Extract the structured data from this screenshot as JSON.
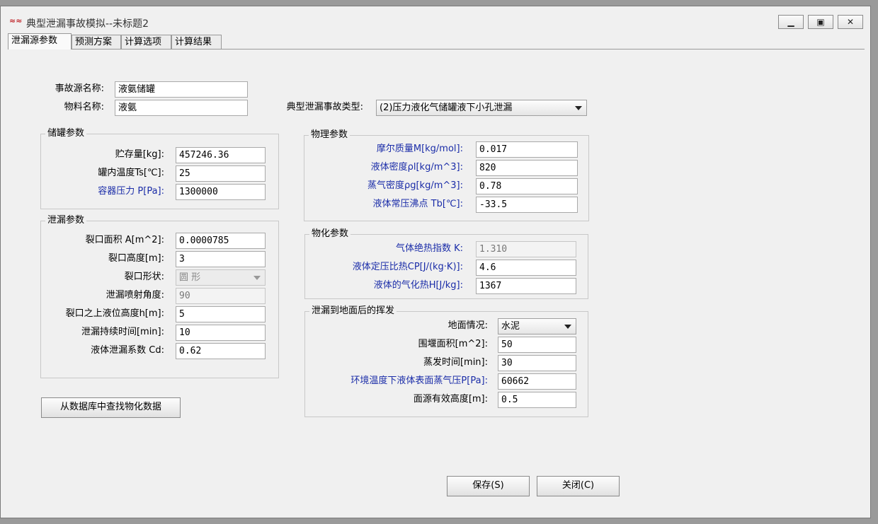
{
  "window": {
    "title": "典型泄漏事故模拟--未标题2",
    "minimize_glyph": "▁",
    "restore_glyph": "▣",
    "close_glyph": "✕"
  },
  "tabs": [
    "泄漏源参数",
    "预测方案",
    "计算选项",
    "计算结果"
  ],
  "top": {
    "source_name_label": "事故源名称:",
    "source_name_value": "液氨储罐",
    "material_label": "物料名称:",
    "material_value": "液氨",
    "accident_type_label": "典型泄漏事故类型:",
    "accident_type_value": "(2)压力液化气储罐液下小孔泄漏"
  },
  "tank": {
    "title": "储罐参数",
    "rows": [
      {
        "label": "贮存量[kg]:",
        "value": "457246.36"
      },
      {
        "label": "罐内温度Ts[℃]:",
        "value": "25"
      },
      {
        "label": "容器压力 P[Pa]:",
        "value": "1300000"
      }
    ]
  },
  "leak": {
    "title": "泄漏参数",
    "area_label": "裂口面积 A[m^2]:",
    "area_value": "0.0000785",
    "height_label": "裂口高度[m]:",
    "height_value": "3",
    "shape_label": "裂口形状:",
    "shape_value": "圆  形",
    "angle_label": "泄漏喷射角度:",
    "angle_value": "90",
    "level_label": "裂口之上液位高度h[m]:",
    "level_value": "5",
    "duration_label": "泄漏持续时间[min]:",
    "duration_value": "10",
    "coef_label": "液体泄漏系数  Cd:",
    "coef_value": "0.62"
  },
  "lookup_button": "从数据库中查找物化数据",
  "physical": {
    "title": "物理参数",
    "rows": [
      {
        "label": "摩尔质量M[kg/mol]:",
        "value": "0.017"
      },
      {
        "label": "液体密度ρl[kg/m^3]:",
        "value": "820"
      },
      {
        "label": "蒸气密度ρg[kg/m^3]:",
        "value": "0.78"
      },
      {
        "label": "液体常压沸点 Tb[℃]:",
        "value": "-33.5"
      }
    ]
  },
  "chem": {
    "title": "物化参数",
    "rows": [
      {
        "label": "气体绝热指数 K:",
        "value": "1.310"
      },
      {
        "label": "液体定压比热CP[J/(kg·K)]:",
        "value": "4.6"
      },
      {
        "label": "液体的气化热H[J/kg]:",
        "value": "1367"
      }
    ]
  },
  "evap": {
    "title": "泄漏到地面后的挥发",
    "ground_label": "地面情况:",
    "ground_value": "水泥",
    "dike_label": "围堰面积[m^2]:",
    "dike_value": "50",
    "time_label": "蒸发时间[min]:",
    "time_value": "30",
    "vp_label": "环境温度下液体表面蒸气压P[Pa]:",
    "vp_value": "60662",
    "height_label": "面源有效高度[m]:",
    "height_value": "0.5"
  },
  "buttons": {
    "save": "保存(S)",
    "close": "关闭(C)"
  },
  "colors": {
    "blue_label": "#1a2ca8",
    "window_bg": "#f0f0f0"
  }
}
